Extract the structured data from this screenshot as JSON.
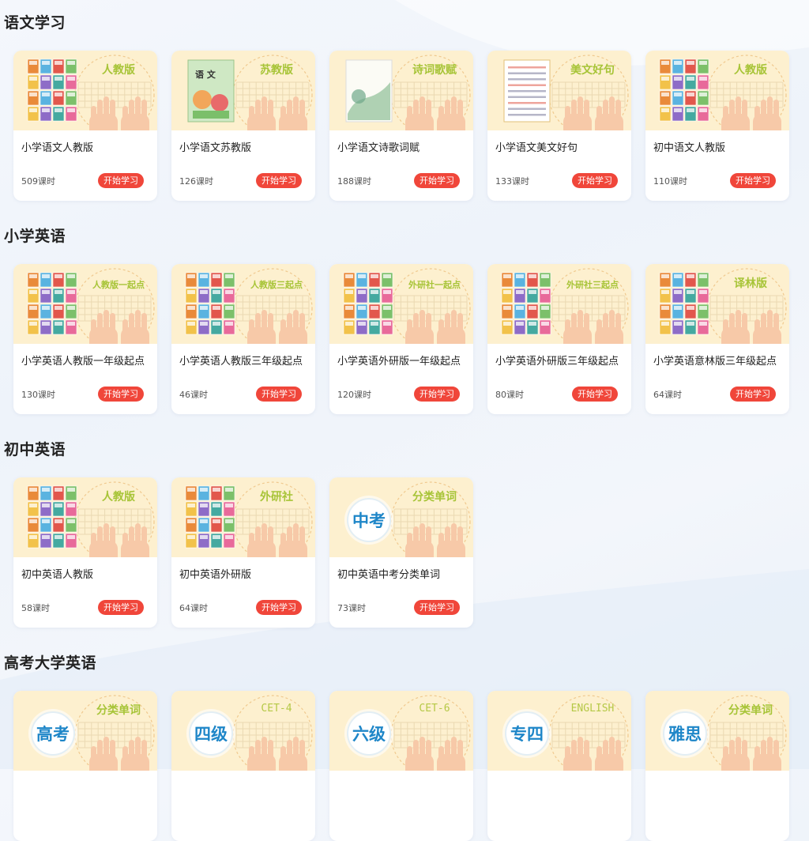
{
  "accent_color": "#f0463a",
  "cover_color": "#fdf0cf",
  "label_color": "#a7c437",
  "sections": [
    {
      "title": "语文学习",
      "courses": [
        {
          "edition": "人教版",
          "name": "小学语文人教版",
          "hours": "509课时",
          "cta": "开始学习",
          "cover": "books-grid"
        },
        {
          "edition": "苏教版",
          "name": "小学语文苏教版",
          "hours": "126课时",
          "cta": "开始学习",
          "cover": "textbook",
          "cover_text": "语 文"
        },
        {
          "edition": "诗词歌赋",
          "name": "小学语文诗歌词赋",
          "hours": "188课时",
          "cta": "开始学习",
          "cover": "painting"
        },
        {
          "edition": "美文好句",
          "name": "小学语文美文好句",
          "hours": "133课时",
          "cta": "开始学习",
          "cover": "text-page"
        },
        {
          "edition": "人教版",
          "name": "初中语文人教版",
          "hours": "110课时",
          "cta": "开始学习",
          "cover": "books-grid"
        }
      ]
    },
    {
      "title": "小学英语",
      "courses": [
        {
          "edition": "人教版一起点",
          "name": "小学英语人教版一年级起点",
          "hours": "130课时",
          "cta": "开始学习",
          "cover": "books-grid"
        },
        {
          "edition": "人教版三起点",
          "name": "小学英语人教版三年级起点",
          "hours": "46课时",
          "cta": "开始学习",
          "cover": "books-grid"
        },
        {
          "edition": "外研社一起点",
          "name": "小学英语外研版一年级起点",
          "hours": "120课时",
          "cta": "开始学习",
          "cover": "books-grid"
        },
        {
          "edition": "外研社三起点",
          "name": "小学英语外研版三年级起点",
          "hours": "80课时",
          "cta": "开始学习",
          "cover": "books-grid"
        },
        {
          "edition": "译林版",
          "name": "小学英语意林版三年级起点",
          "hours": "64课时",
          "cta": "开始学习",
          "cover": "books-grid"
        }
      ]
    },
    {
      "title": "初中英语",
      "courses": [
        {
          "edition": "人教版",
          "name": "初中英语人教版",
          "hours": "58课时",
          "cta": "开始学习",
          "cover": "books-grid"
        },
        {
          "edition": "外研社",
          "name": "初中英语外研版",
          "hours": "64课时",
          "cta": "开始学习",
          "cover": "books-grid"
        },
        {
          "edition": "分类单词",
          "name": "初中英语中考分类单词",
          "hours": "73课时",
          "cta": "开始学习",
          "cover": "badge",
          "badge": "中考"
        }
      ]
    },
    {
      "title": "高考大学英语",
      "courses": [
        {
          "edition": "分类单词",
          "badge": "高考",
          "cover": "badge"
        },
        {
          "edition": "CET-4",
          "badge": "四级",
          "cover": "badge"
        },
        {
          "edition": "CET-6",
          "badge": "六级",
          "cover": "badge"
        },
        {
          "edition": "ENGLISH",
          "badge": "专四",
          "cover": "badge"
        },
        {
          "edition": "分类单词",
          "badge": "雅思",
          "cover": "badge"
        }
      ]
    }
  ]
}
